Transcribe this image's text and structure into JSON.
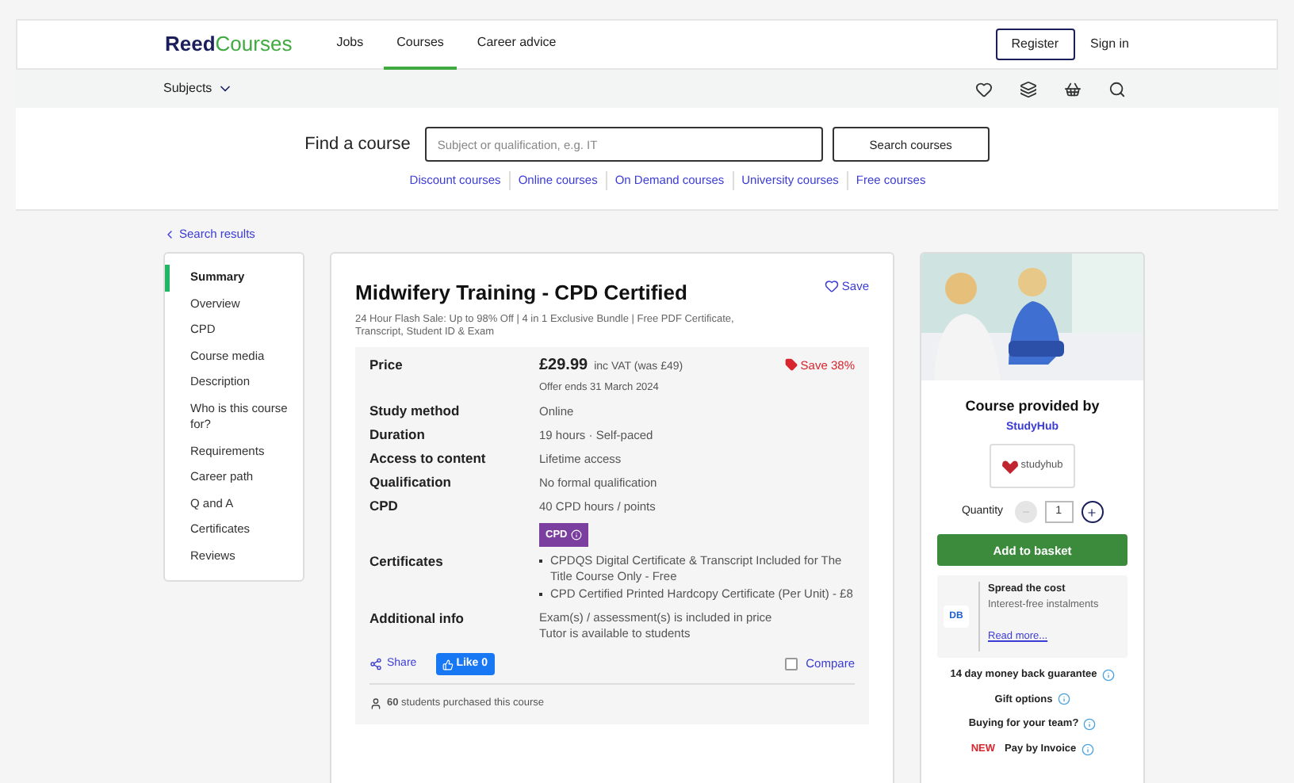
{
  "logo": {
    "brand": "Reed",
    "product": "Courses"
  },
  "nav": [
    {
      "label": "Jobs",
      "selected": false
    },
    {
      "label": "Courses",
      "selected": true
    },
    {
      "label": "Career advice",
      "selected": false
    }
  ],
  "account": {
    "register": "Register",
    "sign_in": "Sign in"
  },
  "subjects": "Subjects",
  "search": {
    "label": "Find a course",
    "placeholder": "Subject or qualification, e.g. IT",
    "button": "Search courses"
  },
  "quick_links": [
    "Discount courses",
    "Online courses",
    "On Demand courses",
    "University courses",
    "Free courses"
  ],
  "back_link": "Search results",
  "sidebar": [
    {
      "label": "Summary",
      "selected": true
    },
    {
      "label": "Overview",
      "selected": false
    },
    {
      "label": "CPD",
      "selected": false
    },
    {
      "label": "Course media",
      "selected": false
    },
    {
      "label": "Description",
      "selected": false
    },
    {
      "label": "Who is this course for?",
      "selected": false
    },
    {
      "label": "Requirements",
      "selected": false
    },
    {
      "label": "Career path",
      "selected": false
    },
    {
      "label": "Q and A",
      "selected": false
    },
    {
      "label": "Certificates",
      "selected": false
    },
    {
      "label": "Reviews",
      "selected": false
    }
  ],
  "course": {
    "title": "Midwifery Training - CPD Certified",
    "save": "Save",
    "subtitle": "24 Hour Flash Sale: Up to 98% Off | 4 in 1 Exclusive Bundle | Free PDF Certificate, Transcript, Student ID & Exam",
    "details": [
      {
        "kind": "price",
        "label": "Price",
        "amount": "£29.99",
        "note": "inc VAT (was £49)",
        "offer": "Offer ends 31 March 2024",
        "save": "Save 38%"
      },
      {
        "kind": "text",
        "label": "Study method",
        "value": "Online"
      },
      {
        "kind": "text",
        "label": "Duration",
        "value": "19 hours · Self-paced"
      },
      {
        "kind": "text",
        "label": "Access to content",
        "value": "Lifetime access"
      },
      {
        "kind": "text",
        "label": "Qualification",
        "value": "No formal qualification"
      },
      {
        "kind": "cpd",
        "label": "CPD",
        "value": "40 CPD hours / points",
        "badge": "CPD"
      },
      {
        "kind": "list",
        "label": "Certificates",
        "items": [
          "CPDQS Digital Certificate & Transcript Included for The Title Course Only - Free",
          "CPD Certified Printed Hardcopy Certificate (Per Unit) - £8"
        ]
      },
      {
        "kind": "lines",
        "label": "Additional info",
        "lines": [
          "Exam(s) / assessment(s) is included in price",
          "Tutor is available to students"
        ]
      }
    ],
    "share": "Share",
    "like": "Like 0",
    "compare": {
      "label": "Compare",
      "checked": false
    },
    "purchased": "**60** students purchased this course"
  },
  "provider": {
    "heading": "Course provided by",
    "name": "StudyHub",
    "logo_text": "studyhub"
  },
  "quantity": {
    "label": "Quantity",
    "value": "1",
    "minus_disabled": true
  },
  "basket": "Add to basket",
  "spread": {
    "badge": "DB",
    "title": "Spread the cost",
    "text": "Interest-free instalments",
    "link": "Read more..."
  },
  "perks": [
    {
      "kind": "plain",
      "label": "14 day money back guarantee"
    },
    {
      "kind": "plain",
      "label": "Gift options"
    },
    {
      "kind": "plain",
      "label": "Buying for your team?"
    },
    {
      "kind": "new",
      "tag": "NEW",
      "label": "Pay by Invoice"
    }
  ]
}
